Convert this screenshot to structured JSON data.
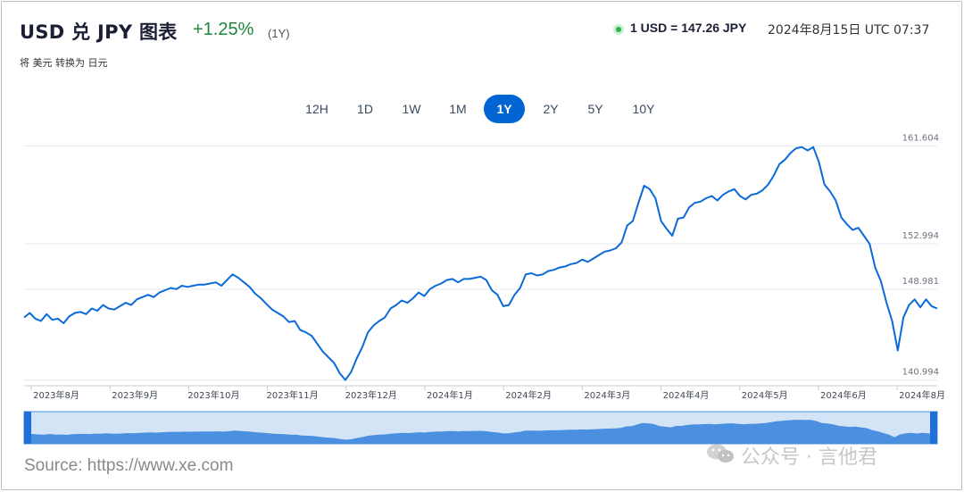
{
  "header": {
    "title": "USD 兑 JPY 图表",
    "change": "+1.25%",
    "period": "(1Y)",
    "subtitle": "将 美元 转换为 日元",
    "rate": "1 USD = 147.26 JPY",
    "timestamp": "2024年8月15日 UTC 07:37"
  },
  "tabs": [
    {
      "label": "12H",
      "active": false
    },
    {
      "label": "1D",
      "active": false
    },
    {
      "label": "1W",
      "active": false
    },
    {
      "label": "1M",
      "active": false
    },
    {
      "label": "1Y",
      "active": true
    },
    {
      "label": "2Y",
      "active": false
    },
    {
      "label": "5Y",
      "active": false
    },
    {
      "label": "10Y",
      "active": false
    }
  ],
  "colors": {
    "line": "#0a6bd8",
    "accent": "#0064d2",
    "positive": "#1a8a3a",
    "navigator_fill": "#4a8fe0",
    "navigator_bg": "#d4e4f7"
  },
  "chart_data": {
    "type": "line",
    "y_ticks": [
      "161.604",
      "152.994",
      "148.981",
      "140.994"
    ],
    "ylim": [
      140.5,
      162.5
    ],
    "x_labels": [
      "2023年8月",
      "2023年9月",
      "2023年10月",
      "2023年11月",
      "2023年12月",
      "2024年1月",
      "2024年2月",
      "2024年3月",
      "2024年4月",
      "2024年5月",
      "2024年6月",
      "2024年8月"
    ],
    "series": [
      {
        "values": [
          146.5,
          146.9,
          146.4,
          146.2,
          146.8,
          146.3,
          146.4,
          146.0,
          146.6,
          146.9,
          147.0,
          146.8,
          147.3,
          147.1,
          147.6,
          147.3,
          147.2,
          147.5,
          147.8,
          147.6,
          148.1,
          148.3,
          148.5,
          148.3,
          148.7,
          148.9,
          149.1,
          149.0,
          149.3,
          149.2,
          149.3,
          149.4,
          149.4,
          149.5,
          149.6,
          149.3,
          149.8,
          150.3,
          150.0,
          149.6,
          149.2,
          148.6,
          148.2,
          147.7,
          147.2,
          146.9,
          146.6,
          146.1,
          146.2,
          145.4,
          145.2,
          144.9,
          144.2,
          143.5,
          143.0,
          142.5,
          141.6,
          141.0,
          141.7,
          142.9,
          143.9,
          145.2,
          145.8,
          146.2,
          146.5,
          147.3,
          147.6,
          148.0,
          147.8,
          148.2,
          148.7,
          148.4,
          149.0,
          149.3,
          149.5,
          149.8,
          149.9,
          149.6,
          149.9,
          149.9,
          150.0,
          150.1,
          149.8,
          148.9,
          148.5,
          147.5,
          147.6,
          148.5,
          149.1,
          150.3,
          150.4,
          150.2,
          150.3,
          150.6,
          150.7,
          150.9,
          151.0,
          151.2,
          151.3,
          151.6,
          151.4,
          151.7,
          152.0,
          152.3,
          152.4,
          152.6,
          153.1,
          154.6,
          155.0,
          156.6,
          158.1,
          157.8,
          157.0,
          155.0,
          154.3,
          153.7,
          155.2,
          155.3,
          156.2,
          156.6,
          156.7,
          157.0,
          157.2,
          156.8,
          157.3,
          157.6,
          157.8,
          157.2,
          156.9,
          157.3,
          157.4,
          157.7,
          158.2,
          159.0,
          160.0,
          160.4,
          161.0,
          161.4,
          161.5,
          161.2,
          161.5,
          160.2,
          158.2,
          157.6,
          156.8,
          155.3,
          154.7,
          154.2,
          154.4,
          153.7,
          153.0,
          150.9,
          149.7,
          147.8,
          146.2,
          143.6,
          146.5,
          147.6,
          148.1,
          147.4,
          148.1,
          147.5,
          147.3
        ]
      }
    ]
  },
  "source": "Source: https://www.xe.com",
  "watermark": "公众号 · 言他君"
}
